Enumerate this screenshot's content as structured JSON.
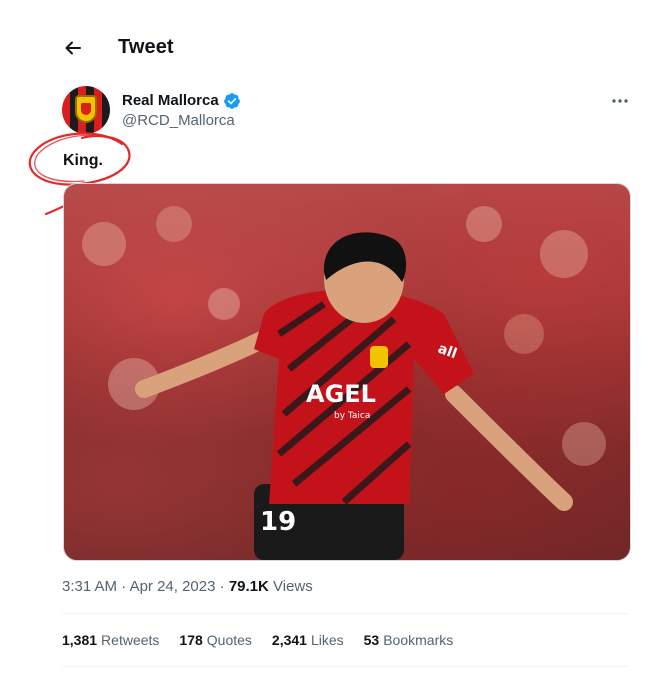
{
  "header": {
    "title": "Tweet"
  },
  "author": {
    "display_name": "Real Mallorca",
    "handle": "@RCD_Mallorca"
  },
  "tweet": {
    "text": "King."
  },
  "media": {
    "jersey_sponsor": "AGEL",
    "jersey_sponsor_sub": "by Taica",
    "jersey_number": "19",
    "sleeve_text": "all"
  },
  "meta": {
    "time": "3:31 AM",
    "date": "Apr 24, 2023",
    "views_count": "79.1K",
    "views_label": "Views",
    "separator": "·"
  },
  "stats": [
    {
      "count": "1,381",
      "label": "Retweets"
    },
    {
      "count": "178",
      "label": "Quotes"
    },
    {
      "count": "2,341",
      "label": "Likes"
    },
    {
      "count": "53",
      "label": "Bookmarks"
    }
  ],
  "colors": {
    "accent_verified": "#1d9bf0",
    "annotation": "#e02b2b",
    "secondary_text": "#536471"
  },
  "icons": {
    "back": "arrow-left-icon",
    "verified": "verified-badge-icon",
    "more": "more-dots-icon"
  }
}
